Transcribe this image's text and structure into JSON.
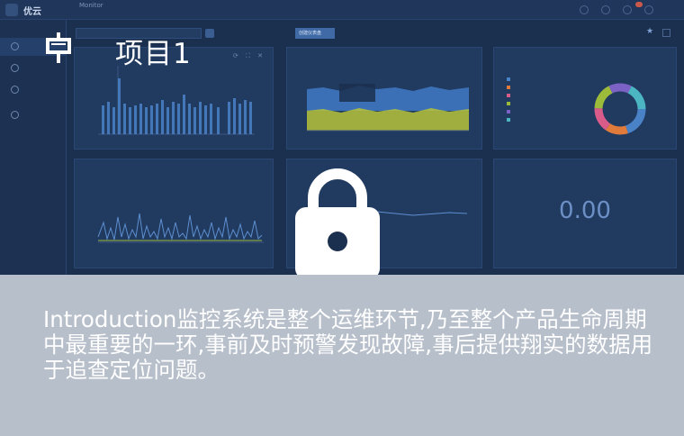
{
  "card": {
    "title": "项目1",
    "description": "Introduction监控系统是整个运维环节,乃至整个产品生命周期中最重要的一环,事前及时预警发现故障,事后提供翔实的数据用于追查定位问题。",
    "icon": "presentation-board-icon",
    "lock_icon": "lock-icon"
  },
  "dashboard": {
    "brand": "优云",
    "breadcrumb": "Monitor",
    "filter_button": "创建仪表盘",
    "big_value": "0.00",
    "colors": {
      "background": "#1b2f4f",
      "panel": "#213a60",
      "bar": "#4a82c8",
      "area_top": "#3f77c0",
      "area_bottom": "#b6c23a"
    }
  },
  "colors": {
    "overlay_panel": "#b7bfcb",
    "text": "#ffffff"
  }
}
